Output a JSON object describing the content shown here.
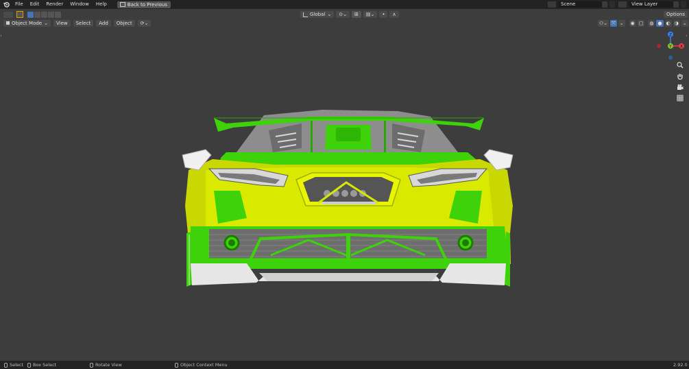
{
  "menu": {
    "file": "File",
    "edit": "Edit",
    "render": "Render",
    "window": "Window",
    "help": "Help",
    "back": "Back to Previous"
  },
  "scene": {
    "name": "Scene",
    "view_layer": "View Layer"
  },
  "header": {
    "mode": "Object Mode",
    "view": "View",
    "select": "Select",
    "add": "Add",
    "object": "Object",
    "transform_orientation": "Global",
    "options": "Options"
  },
  "axes": {
    "z": "Z",
    "y": "Y",
    "x": "X"
  },
  "status": {
    "select": "Select",
    "box_select": "Box Select",
    "rotate": "Rotate View",
    "context": "Object Context Menu",
    "version": "2.92.0"
  },
  "colors": {
    "accent": "#4772b3",
    "selected": "#3ed20a",
    "active": "#d7e800",
    "viewport_bg": "#3d3d3d"
  }
}
